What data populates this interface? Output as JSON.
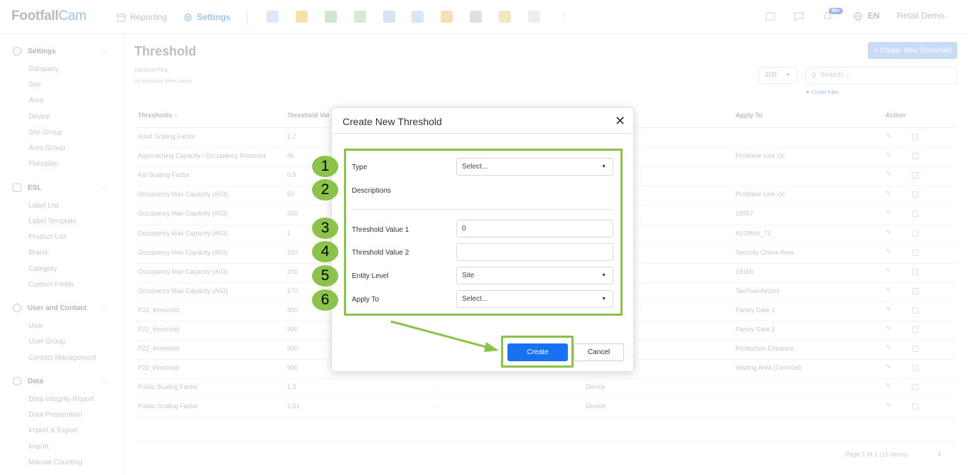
{
  "app": {
    "logo_main": "Footfall",
    "logo_accent": "Cam",
    "nav_reporting": "Reporting",
    "nav_settings": "Settings",
    "badge": "99+",
    "language": "EN",
    "account": "Retail Demo"
  },
  "sidebar": {
    "settings_label": "Settings",
    "settings_items": [
      "Company",
      "Site",
      "Area",
      "Device",
      "Site Group",
      "Area Group",
      "Floorplan"
    ],
    "esl_label": "ESL",
    "esl_items": [
      "Label List",
      "Label Template",
      "Product List",
      "Brand",
      "Category",
      "Custom Fields"
    ],
    "user_label": "User and Contact",
    "user_items": [
      "User",
      "User Group",
      "Contact Management"
    ],
    "data_label": "Data",
    "data_items": [
      "Data Integrity Report",
      "Data Preparation",
      "Import & Export",
      "Import",
      "Manual Counting"
    ]
  },
  "main": {
    "title": "Threshold",
    "favourites_label": "FAVOURITES",
    "favourites_empty": "No favourites filters saved",
    "create_new_button": "+ Create New Threshold",
    "page_size": "100",
    "search_placeholder": "Search...",
    "create_filter": "Create Filter",
    "pager_text": "Page 1 of 1 (15 items)",
    "pager_num": "1"
  },
  "table": {
    "headers": {
      "thresholds": "Thresholds ↑",
      "threshold_value": "Threshold Val",
      "apply_to": "Apply To",
      "action": "Action"
    },
    "rows": [
      {
        "name": "Adult Scaling Factor",
        "value": "1.7",
        "mid": "",
        "level": "",
        "apply": ""
      },
      {
        "name": "Approaching Capacity / Occupancy Restored",
        "value": "45",
        "mid": "",
        "level": "",
        "apply": "ProWave Live Oc"
      },
      {
        "name": "Kid Scaling Factor",
        "value": "0.8",
        "mid": "",
        "level": "",
        "apply": ""
      },
      {
        "name": "Occupancy Max Capacity (A03)",
        "value": "50",
        "mid": "",
        "level": "",
        "apply": "ProWave Live Oc"
      },
      {
        "name": "Occupancy Max Capacity (A03)",
        "value": "300",
        "mid": "",
        "level": "",
        "apply": "18957"
      },
      {
        "name": "Occupancy Max Capacity (A03)",
        "value": "1",
        "mid": "",
        "level": "",
        "apply": "KLOffice_T1"
      },
      {
        "name": "Occupancy Max Capacity (A03)",
        "value": "150",
        "mid": "",
        "level": "",
        "apply": "Security Check Area"
      },
      {
        "name": "Occupancy Max Capacity (A03)",
        "value": "100",
        "mid": "",
        "level": "",
        "apply": "19165"
      },
      {
        "name": "Occupancy Max Capacity (A03)",
        "value": "170",
        "mid": "",
        "level": "",
        "apply": "TaoYuanAirport"
      },
      {
        "name": "P22_threshold",
        "value": "900",
        "mid": "",
        "level": "",
        "apply": "Pantry Gate 1"
      },
      {
        "name": "P22_threshold",
        "value": "900",
        "mid": "",
        "level": "",
        "apply": "Pantry Gate 2"
      },
      {
        "name": "P22_threshold",
        "value": "900",
        "mid": "",
        "level": "",
        "apply": "Production Entrance"
      },
      {
        "name": "P22_threshold",
        "value": "900",
        "mid": "",
        "level": "",
        "apply": "Waiting Area (Centroid)"
      },
      {
        "name": "Public Scaling Factor",
        "value": "1.3",
        "mid": "-",
        "level": "Device",
        "apply": ""
      },
      {
        "name": "Public Scaling Factor",
        "value": "1.01",
        "mid": "-",
        "level": "Device",
        "apply": ""
      }
    ]
  },
  "modal": {
    "title": "Create New Threshold",
    "close": "✕",
    "fields": {
      "type_label": "Type",
      "type_value": "Select...",
      "descriptions_label": "Descriptions",
      "value1_label": "Threshold Value 1",
      "value1_value": "0",
      "value2_label": "Threshold Value 2",
      "value2_value": "",
      "entity_label": "Entity Level",
      "entity_value": "Site",
      "apply_label": "Apply To",
      "apply_value": "Select..."
    },
    "create_button": "Create",
    "cancel_button": "Cancel"
  },
  "annotations": {
    "numbers": [
      "1",
      "2",
      "3",
      "4",
      "5",
      "6"
    ],
    "highlight_color": "#8bc34a"
  }
}
